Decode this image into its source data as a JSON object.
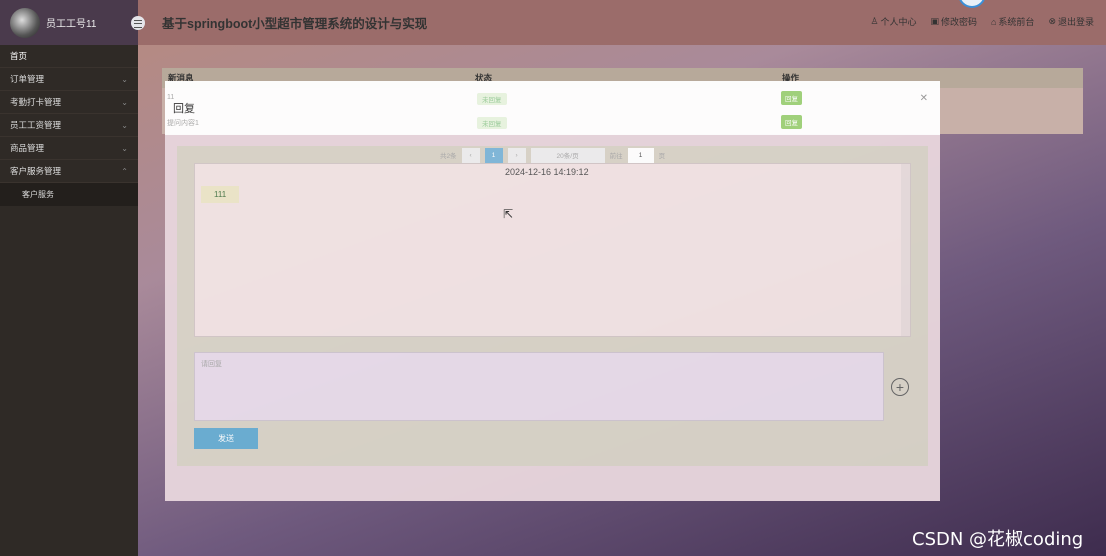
{
  "header": {
    "username": "员工工号11",
    "title": "基于springboot小型超市管理系统的设计与实现",
    "links": [
      "个人中心",
      "修改密码",
      "系统前台",
      "退出登录"
    ]
  },
  "sidebar": {
    "items": [
      {
        "label": "首页"
      },
      {
        "label": "订单管理"
      },
      {
        "label": "考勤打卡管理"
      },
      {
        "label": "员工工资管理"
      },
      {
        "label": "商品管理"
      },
      {
        "label": "客户服务管理"
      }
    ],
    "sub_items": [
      {
        "label": "客户服务"
      }
    ]
  },
  "table": {
    "headers": [
      "新消息",
      "状态",
      "操作"
    ],
    "rows": [
      {
        "message": "11",
        "status": "未回复",
        "action": "回复"
      },
      {
        "message": "提问内容1",
        "status": "未回复",
        "action": "回复"
      }
    ]
  },
  "pager": {
    "total": "共2条",
    "page": "1",
    "per_page": "20条/页",
    "goto": "前往",
    "page_input": "1",
    "page_suffix": "页"
  },
  "dialog": {
    "title": "回复",
    "timestamp": "2024-12-16 14:19:12",
    "bubble_text": "111",
    "reply_placeholder": "请回复",
    "send_label": "发送"
  },
  "watermark": "CSDN @花椒coding"
}
